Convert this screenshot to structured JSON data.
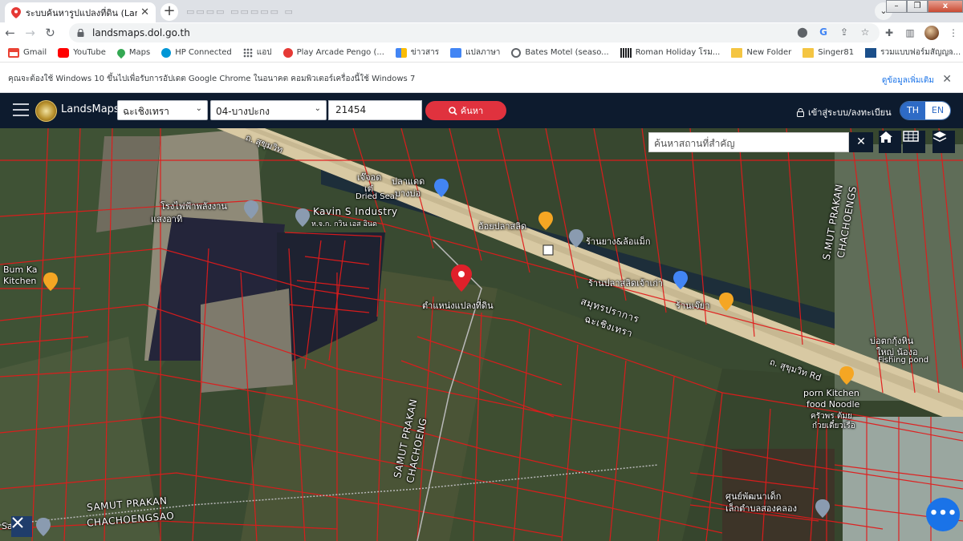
{
  "browser": {
    "tab_title": "ระบบค้นหารูปแปลงที่ดิน (LandsMaps)",
    "new_tab_label": "+",
    "close_tab_label": "✕",
    "url": "landsmaps.dol.go.th",
    "bookmarks": [
      {
        "label": "Gmail",
        "color": "#ea4335"
      },
      {
        "label": "YouTube",
        "color": "#ff0000"
      },
      {
        "label": "Maps",
        "color": "#34a853"
      },
      {
        "label": "HP Connected",
        "color": "#0096d6"
      },
      {
        "label": "แอป",
        "color": "#5f6368"
      },
      {
        "label": "Play Arcade Pengo (...",
        "color": "#e53935"
      },
      {
        "label": "ข่าวสาร",
        "color": "#4285f4"
      },
      {
        "label": "แปลภาษา",
        "color": "#4285f4"
      },
      {
        "label": "Bates Motel (seaso...",
        "color": "#5f6368"
      },
      {
        "label": "Roman Holiday โรม...",
        "color": "#202124"
      },
      {
        "label": "New Folder",
        "color": "#f4c542"
      },
      {
        "label": "Singer81",
        "color": "#f4c542"
      },
      {
        "label": "รวมแบบฟอร์มสัญญา...",
        "color": "#1b4f8a"
      }
    ],
    "more_bookmarks": "»"
  },
  "infobar": {
    "message": "คุณจะต้องใช้ Windows 10 ขึ้นไปเพื่อรับการอัปเดต Google Chrome ในอนาคต คอมพิวเตอร์เครื่องนี้ใช้ Windows 7",
    "more_link": "ดูข้อมูลเพิ่มเติม",
    "close": "✕"
  },
  "app": {
    "brand": "LandsMaps",
    "province": "ฉะเชิงเทรา",
    "district": "04-บางปะกง",
    "parcel_number": "21454",
    "search_label": "ค้นหา",
    "login_label": "เข้าสู่ระบบ/ลงทะเบียน",
    "lang_th": "TH",
    "lang_en": "EN",
    "colors": {
      "header": "#0d1b2e",
      "search": "#e0323e",
      "lang": "#2e6bc6"
    }
  },
  "map": {
    "search_placeholder": "ค้นหาสถานที่สำคัญ",
    "clear_label": "✕",
    "chat_label": "•••",
    "labels": {
      "road_top": "ถ. สุขุมวิท",
      "kavin": "Kavin S Industry",
      "dried": "Dried Seaf",
      "pladat": "ปลาแดด",
      "bangbo": "บางบ่อ",
      "chaijo": "เจ๊จอด",
      "chaijo2": "เต๋",
      "powerplant": "โรงไฟฟ้าพลังงาน",
      "solar": "แสงอาทิ",
      "kpn": "ห.จ.ก. กวิน เอส อินด",
      "oil": "อ้อยปลาสลิด",
      "tire": "ร้านยาง&ล้อแม็ก",
      "bumka": "Bum Ka",
      "kitchen": "Kitchen",
      "parcel": "ตำแหน่งแปลงที่ดิน",
      "shop_salid": "ร้านปลาสลิดเจ้าเก่า",
      "shop_chuay": "ร้านเจ๊ยา",
      "samut_th": "สมุทรปราการ",
      "chach_th": "ฉะเชิงเทรา",
      "samut_v": "S.MUT PRAKAN",
      "chach_v": "CHACHOENGS",
      "fishing": "Fishing pond",
      "bohaikhai": "บ่อตกกุ้งหิน",
      "yai": "ใหญ่ น้องอ",
      "road_mid": "ถ. สุขุมวิท Rd",
      "porn": "porn Kitchen",
      "noodle": "food Noodle",
      "krua": "ครัวพร ต้มย",
      "kuay": "ก๋วยเตี๋ยวเรือ",
      "samut_d": "SAMUT PRAKAN",
      "chach_d": "CHACHOENG",
      "samut_b": "SAMUT PRAKAN",
      "chach_b": "CHACHOENGSAO",
      "center": "ศูนย์พัฒนาเด็ก",
      "center2": "เล็กตำบลสองคลอง",
      "sa": "Sa"
    }
  }
}
